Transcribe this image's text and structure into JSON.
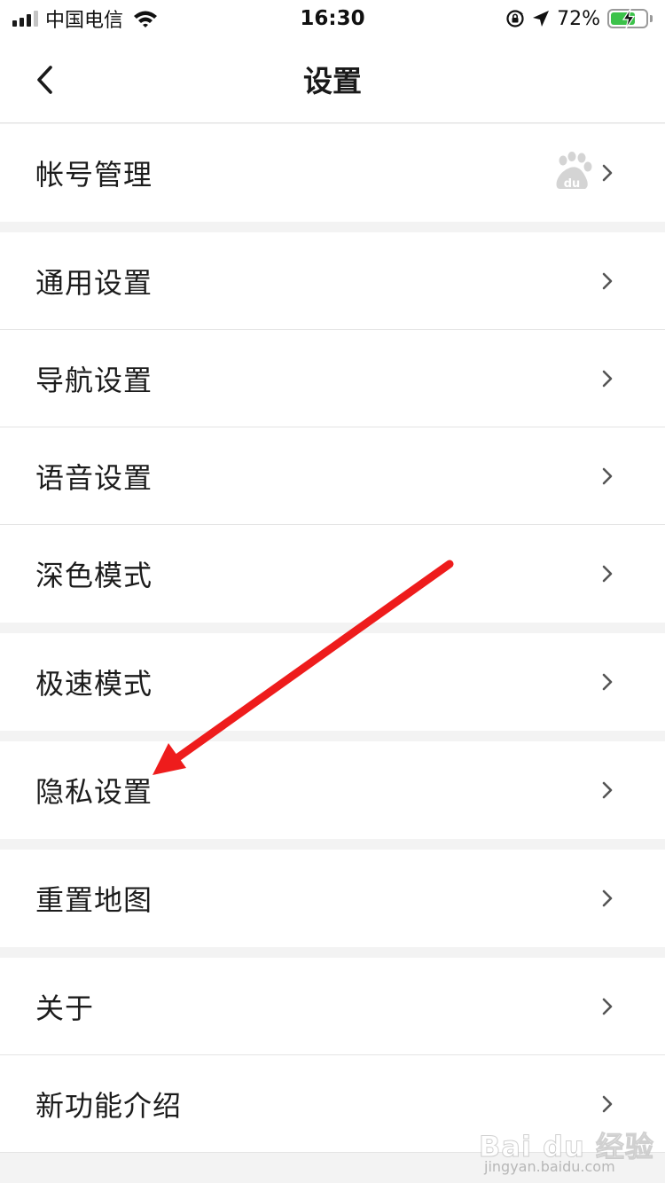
{
  "status_bar": {
    "carrier": "中国电信",
    "time": "16:30",
    "battery_percent": "72%",
    "battery_level": 0.72,
    "signal_bars_active": 3,
    "icons": [
      "signal-icon",
      "wifi-icon",
      "orientation-lock-icon",
      "location-arrow-icon",
      "battery-charging-icon"
    ]
  },
  "navbar": {
    "title": "设置",
    "back_icon": "chevron-left-icon"
  },
  "settings": {
    "account": {
      "label": "帐号管理",
      "badge_icon": "baidu-paw-icon"
    },
    "general": {
      "label": "通用设置"
    },
    "navigation": {
      "label": "导航设置"
    },
    "voice": {
      "label": "语音设置"
    },
    "dark_mode": {
      "label": "深色模式"
    },
    "fast_mode": {
      "label": "极速模式"
    },
    "privacy": {
      "label": "隐私设置"
    },
    "reset_map": {
      "label": "重置地图"
    },
    "about": {
      "label": "关于"
    },
    "new_features": {
      "label": "新功能介绍"
    }
  },
  "annotation": {
    "arrow_color": "#ee1c1c",
    "points_to": "privacy"
  },
  "watermark": {
    "brand": "Bai du 经验",
    "url": "jingyan.baidu.com"
  },
  "colors": {
    "background": "#f3f3f3",
    "row": "#ffffff",
    "divider": "#e4e4e4",
    "chevron": "#555555",
    "battery_fill": "#3cc24a"
  }
}
